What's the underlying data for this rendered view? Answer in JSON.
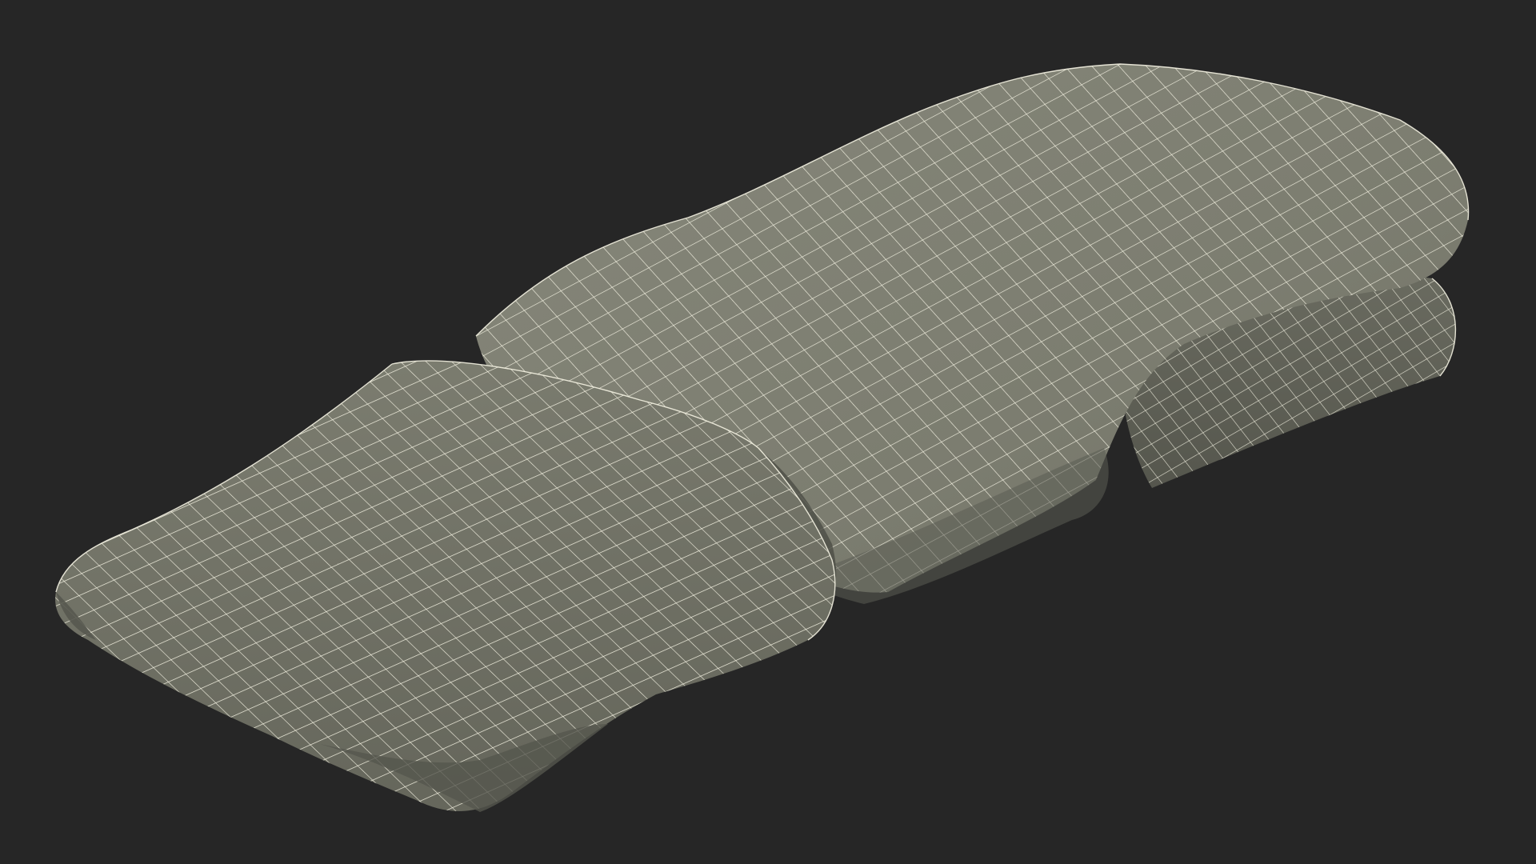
{
  "scene": {
    "subject": "wireframe-mesh-3d-model",
    "colors": {
      "background": "#262626",
      "surface_light": "#8a8b7d",
      "surface_mid": "#7b7c6f",
      "surface_dark": "#5f6056",
      "fold_shadow": "#4a4b43",
      "wire": "#f4f2e2"
    }
  }
}
